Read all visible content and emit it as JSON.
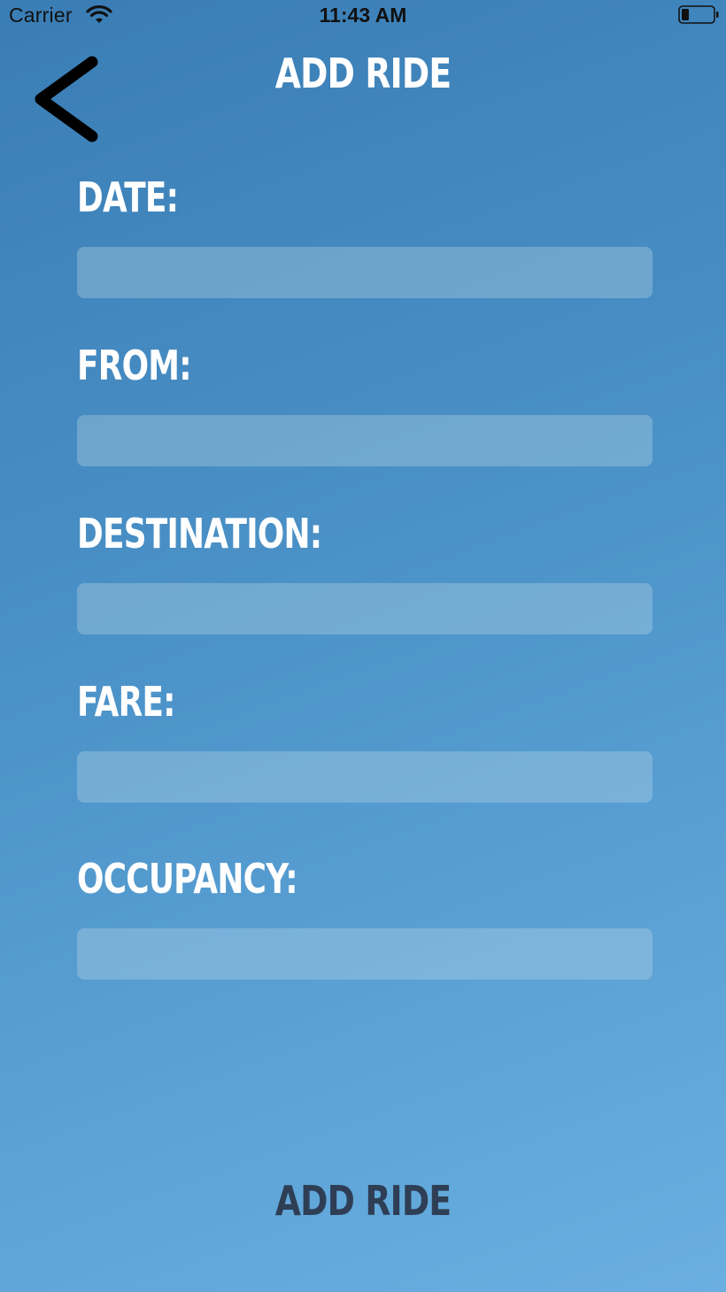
{
  "status_bar": {
    "carrier": "Carrier",
    "time": "11:43 AM",
    "wifi_icon": "wifi-icon",
    "battery_icon": "battery-icon"
  },
  "header": {
    "title": "ADD RIDE",
    "back_icon": "chevron-left-icon"
  },
  "form": {
    "fields": [
      {
        "label": "DATE:",
        "value": "",
        "placeholder": ""
      },
      {
        "label": "FROM:",
        "value": "",
        "placeholder": ""
      },
      {
        "label": "DESTINATION:",
        "value": "",
        "placeholder": ""
      },
      {
        "label": "FARE:",
        "value": "",
        "placeholder": ""
      },
      {
        "label": "OCCUPANCY:",
        "value": "",
        "placeholder": ""
      }
    ],
    "submit_label": "ADD RIDE"
  },
  "colors": {
    "background_top": "#3a7db5",
    "background_bottom": "#6aafe0",
    "text": "#ffffff",
    "submit_text": "#2e3e55",
    "input_fill": "rgba(190,220,235,0.33)"
  }
}
